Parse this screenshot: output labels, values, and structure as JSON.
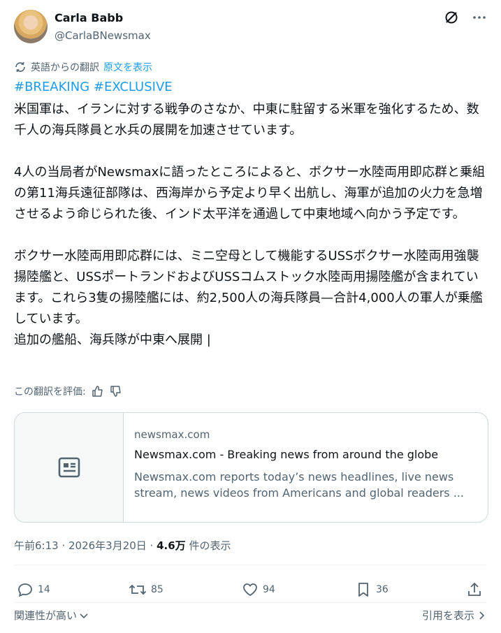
{
  "author": {
    "name": "Carla Babb",
    "handle": "@CarlaBNewsmax"
  },
  "translation": {
    "label": "英語からの翻訳",
    "show_original": "原文を表示"
  },
  "post": {
    "hashtags": "#BREAKING #EXCLUSIVE",
    "body": "米国軍は、イランに対する戦争のさなか、中東に駐留する米軍を強化するため、数千人の海兵隊員と水兵の展開を加速させています。\n\n4人の当局者がNewsmaxに語ったところによると、ボクサー水陸両用即応群と乗組の第11海兵遠征部隊は、西海岸から予定より早く出航し、海軍が追加の火力を急増させるよう命じられた後、インド太平洋を通過して中東地域へ向かう予定です。\n\nボクサー水陸両用即応群には、ミニ空母として機能するUSSボクサー水陸両用強襲揚陸艦と、USSポートランドおよびUSSコムストック水陸両用揚陸艦が含まれています。これら3隻の揚陸艦には、約2,500人の海兵隊員—合計4,000人の軍人が乗艦しています。\n追加の艦船、海兵隊が中東へ展開 |"
  },
  "rate_translation": "この翻訳を評価:",
  "link_card": {
    "domain": "newsmax.com",
    "title": "Newsmax.com - Breaking news from around the globe",
    "description": "Newsmax.com reports today’s news headlines, live news stream, news videos from Americans and global readers ..."
  },
  "meta": {
    "time": "午前6:13 · 2026年3月20日 · ",
    "views_count": "4.6万",
    "views_label": " 件の表示"
  },
  "actions": {
    "replies": "14",
    "reposts": "85",
    "likes": "94",
    "bookmarks": "36"
  },
  "footer": {
    "sort_label": "関連性が高い",
    "quotes_label": "引用を表示"
  },
  "colors": {
    "accent": "#1d9bf0",
    "secondary_text": "#536471",
    "border": "#cfd9de"
  }
}
